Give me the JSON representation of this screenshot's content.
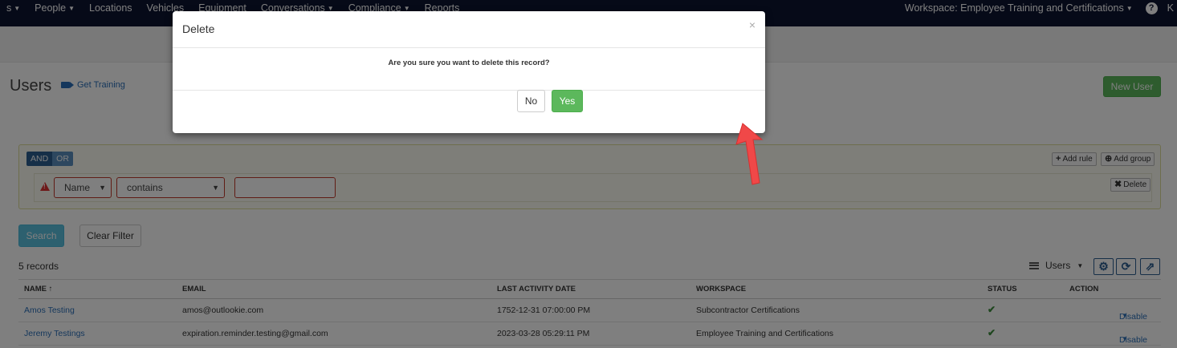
{
  "nav": {
    "items": [
      {
        "label": "s",
        "has_caret": true
      },
      {
        "label": "People",
        "has_caret": true
      },
      {
        "label": "Locations",
        "has_caret": false
      },
      {
        "label": "Vehicles",
        "has_caret": false
      },
      {
        "label": "Equipment",
        "has_caret": false
      },
      {
        "label": "Conversations",
        "has_caret": true
      },
      {
        "label": "Compliance",
        "has_caret": true
      },
      {
        "label": "Reports",
        "has_caret": false
      }
    ],
    "workspace": "Workspace: Employee Training and Certifications",
    "help_icon": "question-circle-icon",
    "user_initial": "K"
  },
  "page": {
    "title": "Users",
    "training_link": "Get Training",
    "training_icon": "video-camera-icon",
    "new_user_button": "New User"
  },
  "filter": {
    "and_label": "AND",
    "or_label": "OR",
    "add_rule": "Add rule",
    "add_group": "Add group",
    "delete": "Delete",
    "field_value": "Name",
    "operator_value": "contains",
    "text_value": ""
  },
  "actions": {
    "search": "Search",
    "clear_filter": "Clear Filter"
  },
  "records_count": "5 records",
  "view_selector": "Users",
  "table": {
    "headers": [
      "NAME ↑",
      "EMAIL",
      "LAST ACTIVITY DATE",
      "WORKSPACE",
      "STATUS",
      "ACTION"
    ],
    "rows": [
      {
        "name": "Amos Testing",
        "email": "amos@outlookie.com",
        "last_activity": "1752-12-31 07:00:00 PM",
        "workspace": "Subcontractor Certifications",
        "status": "✔",
        "action": "Disable"
      },
      {
        "name": "Jeremy Testings",
        "email": "expiration.reminder.testing@gmail.com",
        "last_activity": "2023-03-28 05:29:11 PM",
        "workspace": "Employee Training and Certifications",
        "status": "✔",
        "action": "Disable"
      }
    ]
  },
  "modal": {
    "title": "Delete",
    "close": "×",
    "message": "Are you sure you want to delete this record?",
    "no": "No",
    "yes": "Yes"
  },
  "colors": {
    "nav_bg": "#0c1430",
    "success": "#5cb85c",
    "info": "#5bc0de",
    "link": "#2a6fb8",
    "annotation_arrow": "#f04848"
  }
}
